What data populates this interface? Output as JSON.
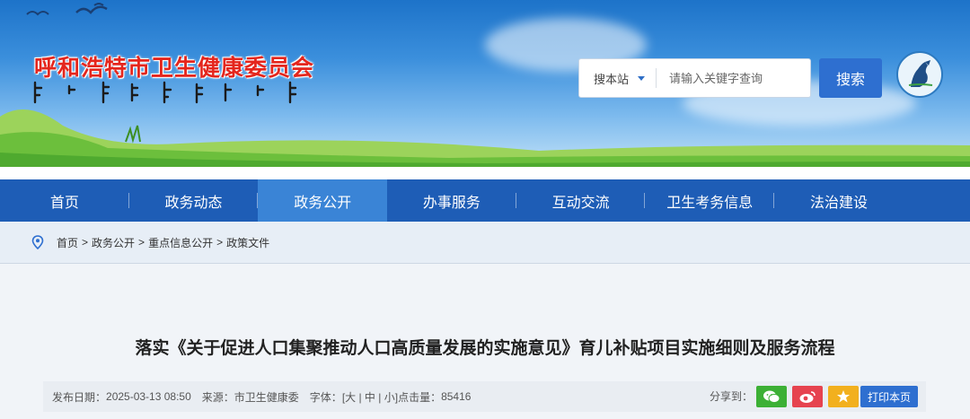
{
  "header": {
    "site_title": "呼和浩特市卫生健康委员会",
    "search": {
      "site_select_label": "搜本站",
      "placeholder": "请输入关键字查询",
      "button_label": "搜索"
    }
  },
  "nav": {
    "items": [
      {
        "label": "首页",
        "active": false
      },
      {
        "label": "政务动态",
        "active": false
      },
      {
        "label": "政务公开",
        "active": true
      },
      {
        "label": "办事服务",
        "active": false
      },
      {
        "label": "互动交流",
        "active": false
      },
      {
        "label": "卫生考务信息",
        "active": false
      },
      {
        "label": "法治建设",
        "active": false
      }
    ]
  },
  "breadcrumb": {
    "items": [
      "首页",
      "政务公开",
      "重点信息公开",
      "政策文件"
    ],
    "separator": ">"
  },
  "article": {
    "title": "落实《关于促进人口集聚推动人口高质量发展的实施意见》育儿补贴项目实施细则及服务流程",
    "publish_label": "发布日期：",
    "publish_date": "2025-03-13 08:50",
    "source_label": "来源：",
    "source": "市卫生健康委",
    "font_label": "字体：",
    "font_options": "[大 | 中 | 小]",
    "views_label": "点击量：",
    "views": "85416",
    "share_label": "分享到：",
    "print_label": "打印本页"
  },
  "colors": {
    "nav_bg": "#1e5db6",
    "nav_active": "#3a84d6",
    "title_red": "#e4261d",
    "search_btn": "#2e6fd0",
    "wechat": "#3cb035",
    "weibo": "#e6434f",
    "favorite": "#f2b01e"
  },
  "icons": {
    "location": "location-pin-icon",
    "wechat": "wechat-icon",
    "weibo": "weibo-icon",
    "favorite": "star-icon"
  }
}
